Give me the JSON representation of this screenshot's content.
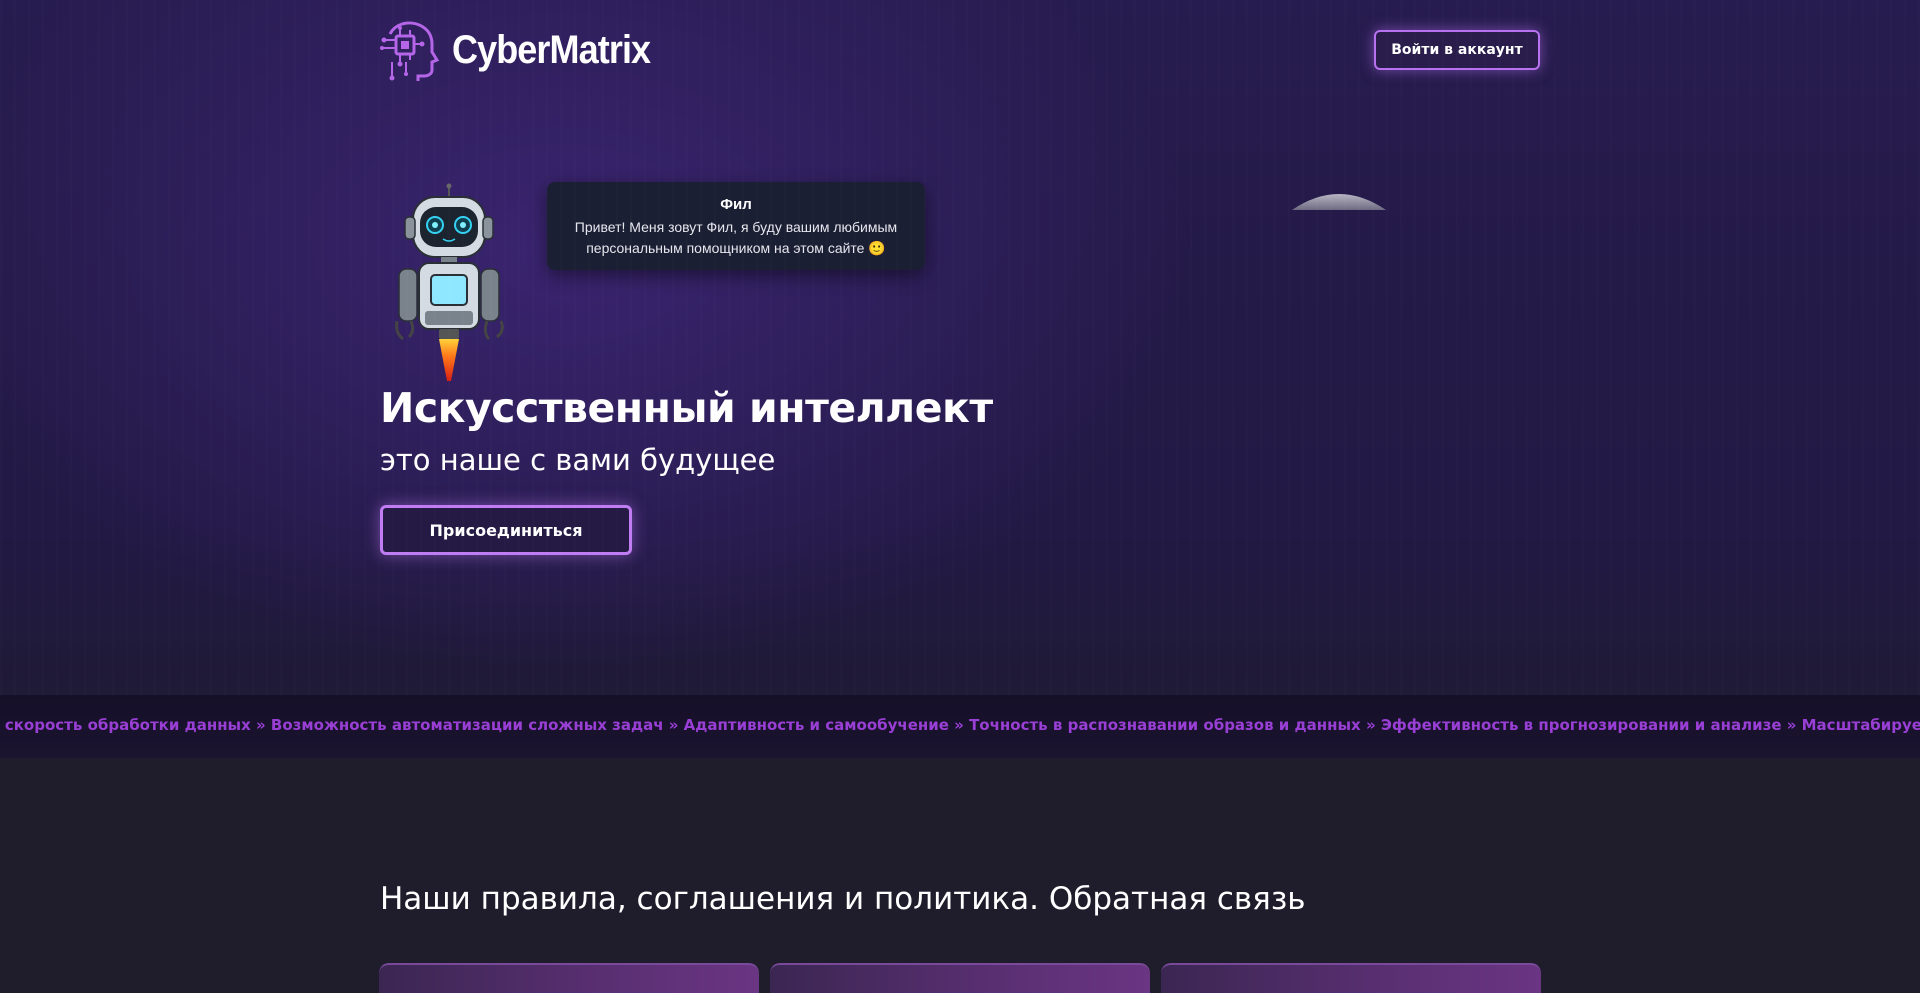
{
  "header": {
    "brand": "CyberMatrix",
    "login_label": "Войти в аккаунт"
  },
  "assistant": {
    "name": "Фил",
    "message": "Привет! Меня зовут Фил, я буду вашим любимым персональным помощником на этом сайте 🙂"
  },
  "hero": {
    "title": "Искусственный интеллект",
    "subtitle": "это наше с вами будущее",
    "cta_label": "Присоединиться"
  },
  "ticker": {
    "text": "я скорость обработки данных » Возможность автоматизации сложных задач » Адаптивность и самообучение » Точность в распознавании образов и данных » Эффективность в прогнозировании и анализе » Масштабируемость для бо"
  },
  "section": {
    "title": "Наши правила, соглашения и политика. Обратная связь"
  },
  "colors": {
    "accent": "#b871f0",
    "ticker_text": "#9a3fd6",
    "background": "#1f1d2b"
  }
}
